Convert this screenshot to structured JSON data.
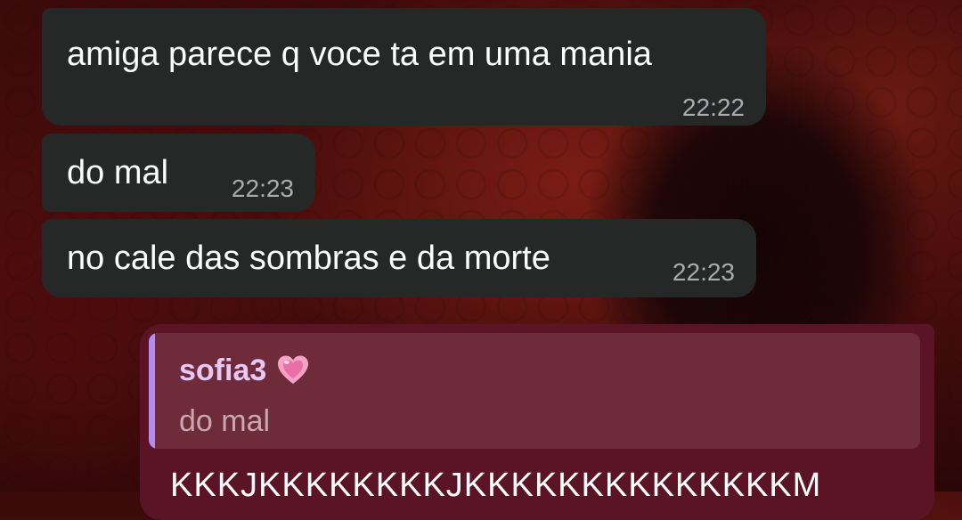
{
  "messages_in": [
    {
      "text": "amiga parece q voce ta em uma mania",
      "time": "22:22"
    },
    {
      "text": "do mal",
      "time": "22:23"
    },
    {
      "text": "no cale das sombras e da morte",
      "time": "22:23"
    }
  ],
  "message_out": {
    "reply": {
      "author": "sofia3",
      "author_icon": "heart-emoji-icon",
      "text": "do mal"
    },
    "text": "KKKJKKKKKKKKJKKKKKKKKKKKKKKM"
  },
  "colors": {
    "incoming_bubble": "#262828",
    "outgoing_bubble": "#5b1425",
    "reply_accent": "#b48cf0",
    "reply_author": "#e7c8f5"
  }
}
